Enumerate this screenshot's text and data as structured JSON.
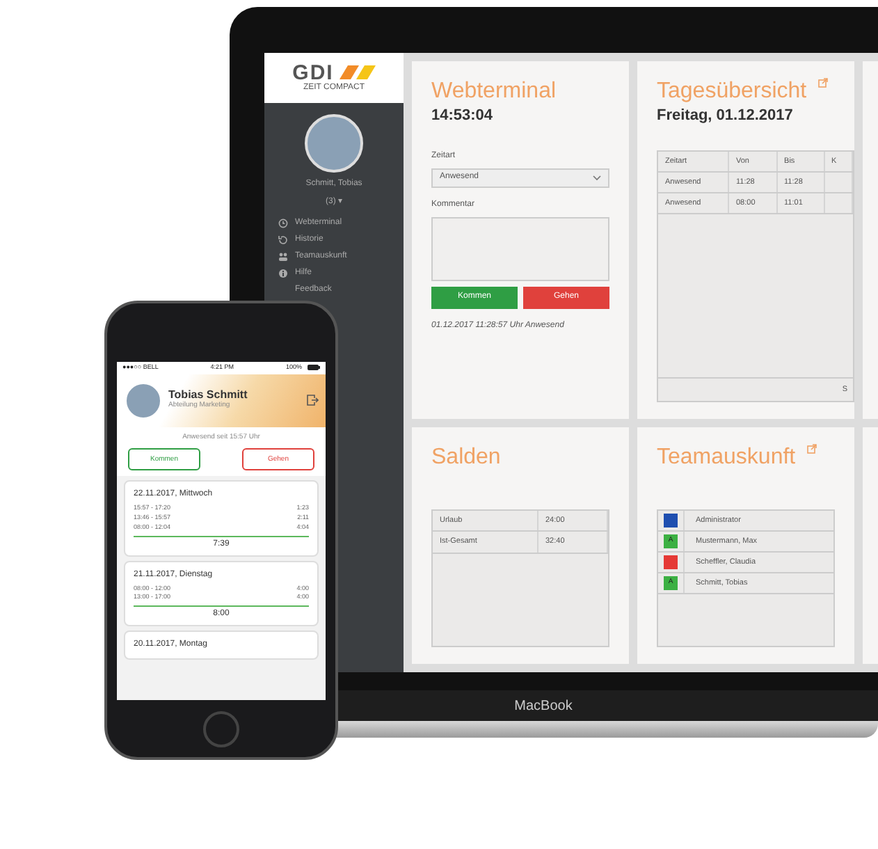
{
  "laptop": {
    "brand_label": "MacBook",
    "logo": {
      "wordmark": "GDI",
      "subtitle": "ZEIT COMPACT"
    },
    "sidebar": {
      "user_name": "Schmitt, Tobias",
      "user_badge": "(3) ▾",
      "items": [
        {
          "label": "Webterminal"
        },
        {
          "label": "Historie"
        },
        {
          "label": "Teamauskunft"
        },
        {
          "label": "Hilfe"
        },
        {
          "label": "Feedback"
        }
      ]
    },
    "webterminal": {
      "title": "Webterminal",
      "clock": "14:53:04",
      "type_label": "Zeitart",
      "type_value": "Anwesend",
      "comment_label": "Kommentar",
      "buttons": [
        {
          "label": "Kommen",
          "kind": "positive"
        },
        {
          "label": "Gehen",
          "kind": "negative"
        }
      ],
      "last_booking": "01.12.2017 11:28:57 Uhr Anwesend"
    },
    "tagesuebersicht": {
      "title": "Tagesübersicht",
      "date": "Freitag, 01.12.2017",
      "table": {
        "columns": [
          "Zeitart",
          "Von",
          "Bis",
          "K"
        ],
        "rows": [
          [
            "Anwesend",
            "11:28",
            "11:28"
          ],
          [
            "Anwesend",
            "08:00",
            "11:01"
          ]
        ],
        "footer": "S"
      }
    },
    "salden": {
      "title": "Salden",
      "rows": [
        [
          "Urlaub",
          "24:00"
        ],
        [
          "Ist-Gesamt",
          "32:40"
        ]
      ]
    },
    "teamauskunft": {
      "title": "Teamauskunft",
      "members": [
        {
          "name": "Administrator",
          "color": "#1f4fb0"
        },
        {
          "name": "Mustermann, Max",
          "color": "#3cb043",
          "letter": "A"
        },
        {
          "name": "Scheffler, Claudia",
          "color": "#e53935"
        },
        {
          "name": "Schmitt, Tobias",
          "color": "#3cb043",
          "letter": "A"
        }
      ]
    }
  },
  "phone": {
    "status_bar": {
      "carrier": "●●●○○ BELL",
      "time": "4:21 PM",
      "battery": "100%"
    },
    "user": {
      "name": "Tobias Schmitt",
      "department": "Abteilung Marketing"
    },
    "presence": "Anwesend seit 15:57 Uhr",
    "buttons": [
      {
        "label": "Kommen",
        "kind": "positive"
      },
      {
        "label": "Gehen",
        "kind": "negative"
      }
    ],
    "days": [
      {
        "title": "22.11.2017, Mittwoch",
        "entries": [
          [
            "15:57 - 17:20",
            "1:23"
          ],
          [
            "13:46 - 15:57",
            "2:11"
          ],
          [
            "08:00 - 12:04",
            "4:04"
          ]
        ],
        "total": "7:39"
      },
      {
        "title": "21.11.2017, Dienstag",
        "entries": [
          [
            "08:00 - 12:00",
            "4:00"
          ],
          [
            "13:00 - 17:00",
            "4:00"
          ]
        ],
        "total": "8:00"
      },
      {
        "title": "20.11.2017, Montag"
      }
    ]
  }
}
